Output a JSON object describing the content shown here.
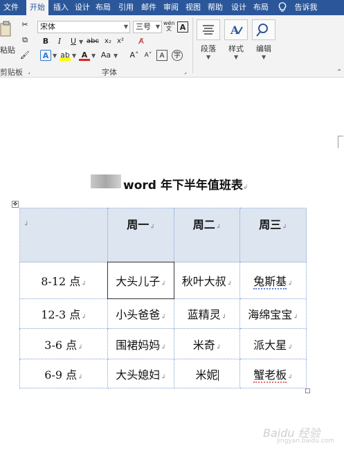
{
  "tabs": [
    "文件",
    "开始",
    "插入",
    "设计",
    "布局",
    "引用",
    "邮件",
    "审阅",
    "视图",
    "帮助",
    "设计",
    "布局",
    "告诉我"
  ],
  "ribbon": {
    "clipboard": {
      "paste": "粘贴",
      "label": "剪贴板"
    },
    "font": {
      "name": "宋体",
      "size": "三号",
      "label": "字体"
    },
    "paragraph": {
      "label": "段落"
    },
    "styles": {
      "label": "样式"
    },
    "editing": {
      "label": "编辑"
    }
  },
  "document": {
    "title": "word 年下半年值班表",
    "table": {
      "header": [
        "",
        "周一",
        "周二",
        "周三"
      ],
      "rows": [
        [
          "8-12 点",
          "大头儿子",
          "秋叶大叔",
          "兔斯基"
        ],
        [
          "12-3 点",
          "小头爸爸",
          "蓝精灵",
          "海绵宝宝"
        ],
        [
          "3-6 点",
          "围裙妈妈",
          "米奇",
          "派大星"
        ],
        [
          "6-9 点",
          "大头媳妇",
          "米妮",
          "蟹老板"
        ]
      ]
    }
  },
  "watermark": {
    "text": "Baidu 经验",
    "sub": "jingyan.baidu.com"
  },
  "colors": {
    "ribbon": "#2b579a",
    "header_fill": "#dde5f0"
  }
}
